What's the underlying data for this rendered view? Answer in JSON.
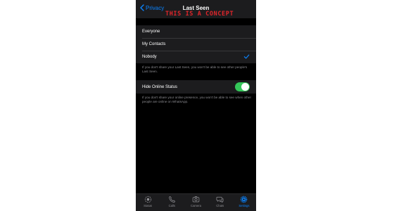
{
  "colors": {
    "accent": "#0a84ff",
    "toggle_on": "#34c759",
    "watermark": "#e0252a"
  },
  "nav": {
    "back_label": "Privacy",
    "title": "Last Seen"
  },
  "watermark": "THIS IS A CONCEPT",
  "last_seen_options": [
    {
      "label": "Everyone",
      "selected": false
    },
    {
      "label": "My Contacts",
      "selected": false
    },
    {
      "label": "Nobody",
      "selected": true
    }
  ],
  "last_seen_footer": "If you don't share your Last Seen, you won't be able to see other people's Last Seen.",
  "online_status": {
    "label": "Hide Online Status",
    "enabled": true
  },
  "online_status_footer": "If you don't share your online presence, you won't be able to see when other people are online on WhatsApp.",
  "tabs": [
    {
      "label": "Status",
      "icon": "status-icon",
      "active": false
    },
    {
      "label": "Calls",
      "icon": "phone-icon",
      "active": false
    },
    {
      "label": "Camera",
      "icon": "camera-icon",
      "active": false
    },
    {
      "label": "Chats",
      "icon": "chats-icon",
      "active": false
    },
    {
      "label": "Settings",
      "icon": "gear-icon",
      "active": true
    }
  ]
}
